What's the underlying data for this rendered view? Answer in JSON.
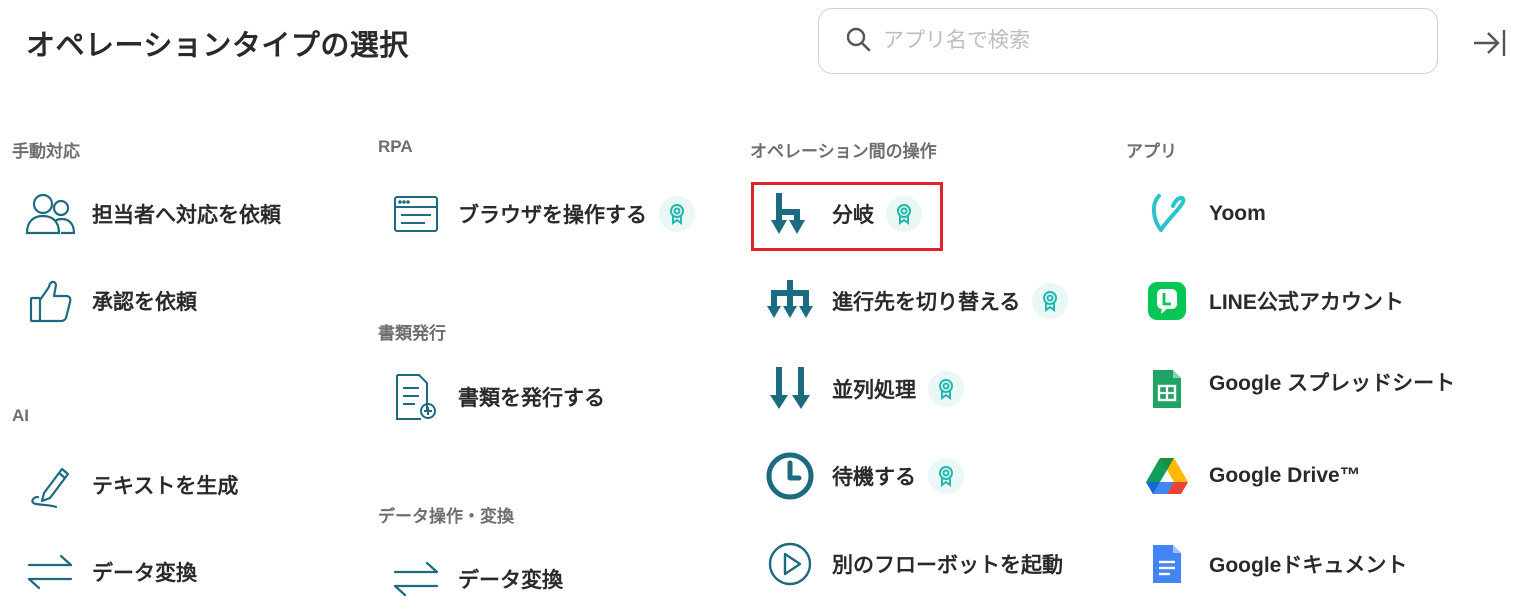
{
  "header": {
    "title": "オペレーションタイプの選択",
    "search_placeholder": "アプリ名で検索",
    "search_value": ""
  },
  "columns": {
    "manual": {
      "heading": "手動対応",
      "items": [
        {
          "label": "担当者へ対応を依頼",
          "icon": "users-icon"
        },
        {
          "label": "承認を依頼",
          "icon": "thumbs-up-icon"
        }
      ]
    },
    "ai": {
      "heading": "AI",
      "items": [
        {
          "label": "テキストを生成",
          "icon": "pen-icon"
        },
        {
          "label": "データ変換",
          "icon": "swap-arrows-icon"
        }
      ]
    },
    "rpa": {
      "heading": "RPA",
      "items": [
        {
          "label": "ブラウザを操作する",
          "icon": "browser-icon",
          "badge": "award-icon"
        }
      ]
    },
    "document": {
      "heading": "書類発行",
      "items": [
        {
          "label": "書類を発行する",
          "icon": "document-add-icon"
        }
      ]
    },
    "data_ops": {
      "heading": "データ操作・変換",
      "items": [
        {
          "label": "データ変換",
          "icon": "swap-arrows-icon"
        }
      ]
    },
    "flow_ops": {
      "heading": "オペレーション間の操作",
      "items": [
        {
          "label": "分岐",
          "icon": "branch-icon",
          "badge": "award-icon",
          "selected": true
        },
        {
          "label": "進行先を切り替える",
          "icon": "multi-branch-icon",
          "badge": "award-icon"
        },
        {
          "label": "並列処理",
          "icon": "parallel-arrows-icon",
          "badge": "award-icon"
        },
        {
          "label": "待機する",
          "icon": "clock-icon",
          "badge": "award-icon"
        },
        {
          "label": "別のフローボットを起動",
          "icon": "play-circle-icon"
        }
      ]
    },
    "apps": {
      "heading": "アプリ",
      "items": [
        {
          "label": "Yoom",
          "icon": "yoom-logo-icon"
        },
        {
          "label": "LINE公式アカウント",
          "icon": "line-logo-icon"
        },
        {
          "label": "Google スプレッドシート",
          "icon": "google-sheets-icon"
        },
        {
          "label": "Google Drive™",
          "icon": "google-drive-icon"
        },
        {
          "label": "Googleドキュメント",
          "icon": "google-docs-icon"
        }
      ]
    }
  },
  "colors": {
    "accent_teal": "#1c6b80",
    "badge_bg": "#e9f7f6",
    "badge_fg": "#22b8ad",
    "selection_red": "#e0222a",
    "line_green": "#06c755",
    "sheets_green": "#1fa463",
    "docs_blue": "#4285f4",
    "yoom_teal": "#2cc3c9"
  }
}
